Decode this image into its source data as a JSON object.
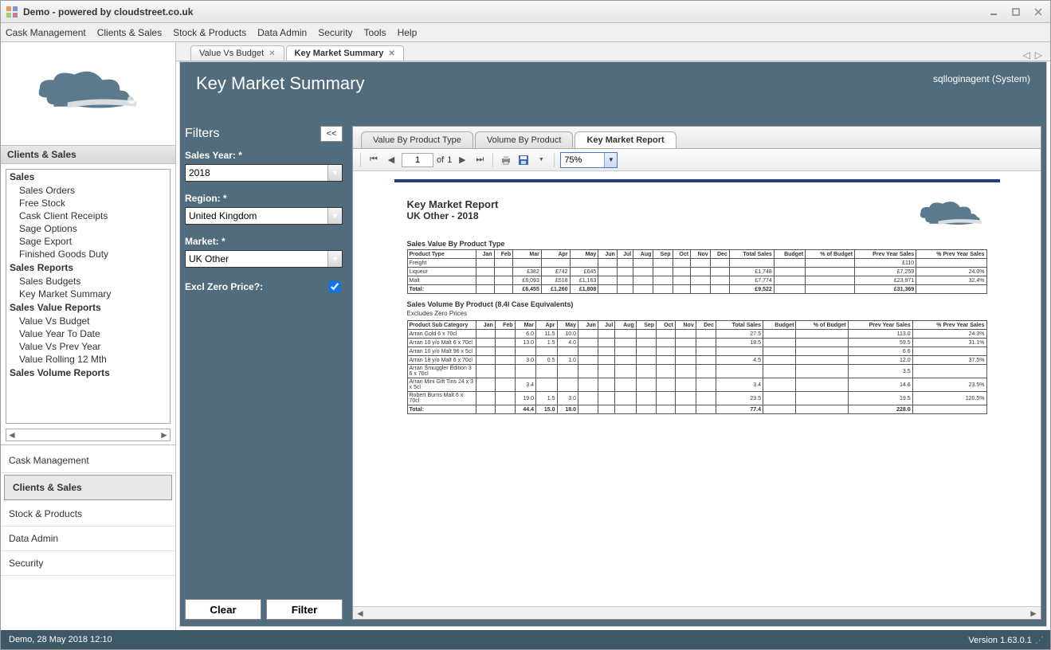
{
  "window": {
    "title": "Demo - powered by cloudstreet.co.uk"
  },
  "menubar": [
    "Cask Management",
    "Clients & Sales",
    "Stock & Products",
    "Data Admin",
    "Security",
    "Tools",
    "Help"
  ],
  "sidebar": {
    "header": "Clients & Sales",
    "tree": {
      "sales": {
        "label": "Sales",
        "items": [
          "Sales Orders",
          "Free Stock",
          "Cask Client Receipts",
          "Sage Options",
          "Sage Export",
          "Finished Goods Duty"
        ]
      },
      "salesReports": {
        "label": "Sales Reports",
        "items": [
          "Sales Budgets",
          "Key Market Summary"
        ]
      },
      "valueReports": {
        "label": "Sales Value Reports",
        "items": [
          "Value Vs Budget",
          "Value Year To Date",
          "Value Vs Prev Year",
          "Value Rolling 12 Mth"
        ]
      },
      "volumeReports": {
        "label": "Sales Volume Reports",
        "items": []
      }
    },
    "modules": [
      "Cask Management",
      "Clients & Sales",
      "Stock & Products",
      "Data Admin",
      "Security"
    ]
  },
  "docTabs": {
    "tab0": "Value Vs Budget",
    "tab1": "Key Market Summary"
  },
  "page": {
    "title": "Key Market Summary",
    "user": "sqlloginagent (System)"
  },
  "filters": {
    "title": "Filters",
    "collapse": "<<",
    "salesYear": {
      "label": "Sales Year: *",
      "value": "2018"
    },
    "region": {
      "label": "Region: *",
      "value": "United Kingdom"
    },
    "market": {
      "label": "Market: *",
      "value": "UK Other"
    },
    "exclZero": {
      "label": "Excl Zero Price?:",
      "checked": true
    },
    "clear": "Clear",
    "filter": "Filter"
  },
  "subTabs": {
    "t0": "Value By Product Type",
    "t1": "Volume By Product",
    "t2": "Key Market Report"
  },
  "rptToolbar": {
    "page": "1",
    "of": "of",
    "pages": "1",
    "zoom": "75%"
  },
  "report": {
    "title": "Key Market Report",
    "subtitle": "UK Other - 2018",
    "section1": "Sales Value By Product Type",
    "section2": "Sales Volume By Product (8.4l Case Equivalents)",
    "note2": "Excludes Zero Prices",
    "cols": [
      "Jan",
      "Feb",
      "Mar",
      "Apr",
      "May",
      "Jun",
      "Jul",
      "Aug",
      "Sep",
      "Oct",
      "Nov",
      "Dec",
      "Total Sales",
      "Budget",
      "% of Budget",
      "Prev Year Sales",
      "% Prev Year Sales"
    ],
    "valueRows": {
      "head": "Product Type",
      "r0": {
        "lbl": "Freight",
        "vals": [
          "",
          "",
          "",
          "",
          "",
          "",
          "",
          "",
          "",
          "",
          "",
          "",
          "",
          "",
          "",
          "£110",
          ""
        ]
      },
      "r1": {
        "lbl": "Liqueur",
        "vals": [
          "",
          "",
          "£382",
          "£742",
          "£645",
          "",
          "",
          "",
          "",
          "",
          "",
          "",
          "£1,748",
          "",
          "",
          "£7,259",
          "24.0%"
        ]
      },
      "r2": {
        "lbl": "Malt",
        "vals": [
          "",
          "",
          "£6,093",
          "£518",
          "£1,163",
          "",
          "",
          "",
          "",
          "",
          "",
          "",
          "£7,774",
          "",
          "",
          "£23,971",
          "32.4%"
        ]
      },
      "total": {
        "lbl": "Total:",
        "vals": [
          "",
          "",
          "£6,455",
          "£1,260",
          "£1,808",
          "",
          "",
          "",
          "",
          "",
          "",
          "",
          "£9,522",
          "",
          "",
          "£31,369",
          ""
        ]
      }
    },
    "volRows": {
      "head": "Product Sub Category",
      "r0": {
        "lbl": "Arran Gold 6 x 70cl",
        "vals": [
          "",
          "",
          "6.0",
          "11.5",
          "10.0",
          "",
          "",
          "",
          "",
          "",
          "",
          "",
          "27.5",
          "",
          "",
          "113.0",
          "24.3%"
        ]
      },
      "r1": {
        "lbl": "Arran 10 y/o Malt  6 x 70cl",
        "vals": [
          "",
          "",
          "13.0",
          "1.5",
          "4.0",
          "",
          "",
          "",
          "",
          "",
          "",
          "",
          "18.5",
          "",
          "",
          "59.5",
          "31.1%"
        ]
      },
      "r2": {
        "lbl": "Arran 10 y/o Malt 96 x 5cl",
        "vals": [
          "",
          "",
          "",
          "",
          "",
          "",
          "",
          "",
          "",
          "",
          "",
          "",
          "",
          "",
          "",
          "6.6",
          ""
        ]
      },
      "r3": {
        "lbl": "Arran 18 y/o Malt 6 x 70cl",
        "vals": [
          "",
          "",
          "3.0",
          "0.5",
          "1.0",
          "",
          "",
          "",
          "",
          "",
          "",
          "",
          "4.5",
          "",
          "",
          "12.0",
          "37.5%"
        ]
      },
      "r4": {
        "lbl": "Arran Smuggler Edition 3  6 x 70cl",
        "vals": [
          "",
          "",
          "",
          "",
          "",
          "",
          "",
          "",
          "",
          "",
          "",
          "",
          "",
          "",
          "",
          "3.5",
          ""
        ]
      },
      "r5": {
        "lbl": "Arran Mini Gift Tins 24 x 3 x 5cl",
        "vals": [
          "",
          "",
          "3.4",
          "",
          "",
          "",
          "",
          "",
          "",
          "",
          "",
          "",
          "3.4",
          "",
          "",
          "14.6",
          "23.5%"
        ]
      },
      "r6": {
        "lbl": "Robert Burns Malt 6 x 70cl",
        "vals": [
          "",
          "",
          "19.0",
          "1.5",
          "3.0",
          "",
          "",
          "",
          "",
          "",
          "",
          "",
          "23.5",
          "",
          "",
          "19.5",
          "120.5%"
        ]
      },
      "total": {
        "lbl": "Total:",
        "vals": [
          "",
          "",
          "44.4",
          "15.0",
          "18.0",
          "",
          "",
          "",
          "",
          "",
          "",
          "",
          "77.4",
          "",
          "",
          "228.0",
          ""
        ]
      }
    }
  },
  "status": {
    "left": "Demo, 28 May 2018 12:10",
    "right": "Version 1.63.0.1"
  }
}
